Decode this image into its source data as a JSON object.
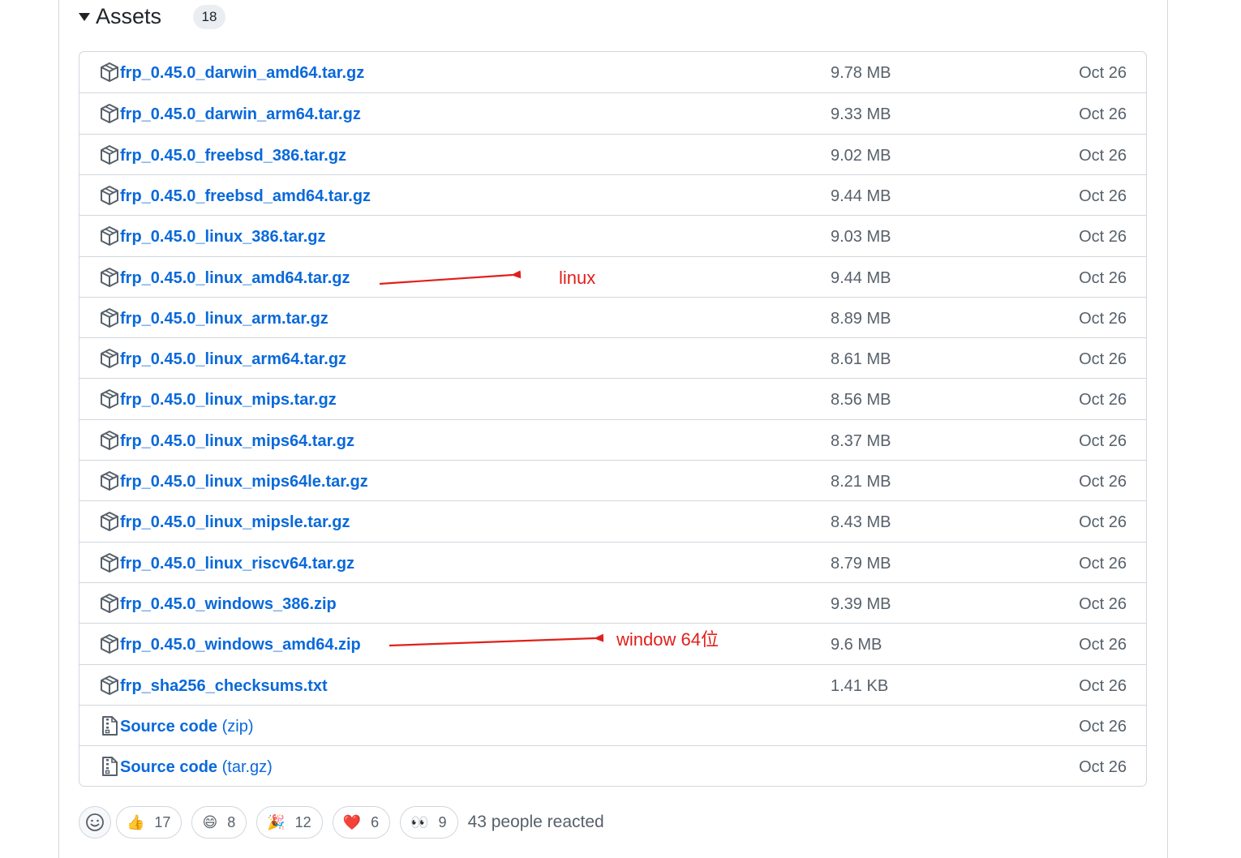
{
  "assets": {
    "title": "Assets",
    "count": "18",
    "items": [
      {
        "name": "frp_0.45.0_darwin_amd64.tar.gz",
        "suffix": "",
        "size": "9.78 MB",
        "date": "Oct 26",
        "icon": "package-icon"
      },
      {
        "name": "frp_0.45.0_darwin_arm64.tar.gz",
        "suffix": "",
        "size": "9.33 MB",
        "date": "Oct 26",
        "icon": "package-icon"
      },
      {
        "name": "frp_0.45.0_freebsd_386.tar.gz",
        "suffix": "",
        "size": "9.02 MB",
        "date": "Oct 26",
        "icon": "package-icon"
      },
      {
        "name": "frp_0.45.0_freebsd_amd64.tar.gz",
        "suffix": "",
        "size": "9.44 MB",
        "date": "Oct 26",
        "icon": "package-icon"
      },
      {
        "name": "frp_0.45.0_linux_386.tar.gz",
        "suffix": "",
        "size": "9.03 MB",
        "date": "Oct 26",
        "icon": "package-icon"
      },
      {
        "name": "frp_0.45.0_linux_amd64.tar.gz",
        "suffix": "",
        "size": "9.44 MB",
        "date": "Oct 26",
        "icon": "package-icon"
      },
      {
        "name": "frp_0.45.0_linux_arm.tar.gz",
        "suffix": "",
        "size": "8.89 MB",
        "date": "Oct 26",
        "icon": "package-icon"
      },
      {
        "name": "frp_0.45.0_linux_arm64.tar.gz",
        "suffix": "",
        "size": "8.61 MB",
        "date": "Oct 26",
        "icon": "package-icon"
      },
      {
        "name": "frp_0.45.0_linux_mips.tar.gz",
        "suffix": "",
        "size": "8.56 MB",
        "date": "Oct 26",
        "icon": "package-icon"
      },
      {
        "name": "frp_0.45.0_linux_mips64.tar.gz",
        "suffix": "",
        "size": "8.37 MB",
        "date": "Oct 26",
        "icon": "package-icon"
      },
      {
        "name": "frp_0.45.0_linux_mips64le.tar.gz",
        "suffix": "",
        "size": "8.21 MB",
        "date": "Oct 26",
        "icon": "package-icon"
      },
      {
        "name": "frp_0.45.0_linux_mipsle.tar.gz",
        "suffix": "",
        "size": "8.43 MB",
        "date": "Oct 26",
        "icon": "package-icon"
      },
      {
        "name": "frp_0.45.0_linux_riscv64.tar.gz",
        "suffix": "",
        "size": "8.79 MB",
        "date": "Oct 26",
        "icon": "package-icon"
      },
      {
        "name": "frp_0.45.0_windows_386.zip",
        "suffix": "",
        "size": "9.39 MB",
        "date": "Oct 26",
        "icon": "package-icon"
      },
      {
        "name": "frp_0.45.0_windows_amd64.zip",
        "suffix": "",
        "size": "9.6 MB",
        "date": "Oct 26",
        "icon": "package-icon"
      },
      {
        "name": "frp_sha256_checksums.txt",
        "suffix": "",
        "size": "1.41 KB",
        "date": "Oct 26",
        "icon": "package-icon"
      },
      {
        "name": "Source code",
        "suffix": " (zip)",
        "size": "",
        "date": "Oct 26",
        "icon": "file-zip-icon"
      },
      {
        "name": "Source code",
        "suffix": " (tar.gz)",
        "size": "",
        "date": "Oct 26",
        "icon": "file-zip-icon"
      }
    ]
  },
  "annotations": {
    "linux_label": "linux",
    "windows_label": "window 64位",
    "color": "#e0201b"
  },
  "reactions": {
    "items": [
      {
        "emoji": "👍",
        "icon": "thumbs-up-icon",
        "count": "17"
      },
      {
        "emoji": "😄",
        "icon": "laugh-icon",
        "count": "8"
      },
      {
        "emoji": "🎉",
        "icon": "hooray-icon",
        "count": "12"
      },
      {
        "emoji": "❤️",
        "icon": "heart-icon",
        "count": "6"
      },
      {
        "emoji": "👀",
        "icon": "eyes-icon",
        "count": "9"
      }
    ],
    "summary": "43 people reacted"
  },
  "colors": {
    "link": "#0969da",
    "muted": "#57606a",
    "border": "#d0d7de"
  }
}
